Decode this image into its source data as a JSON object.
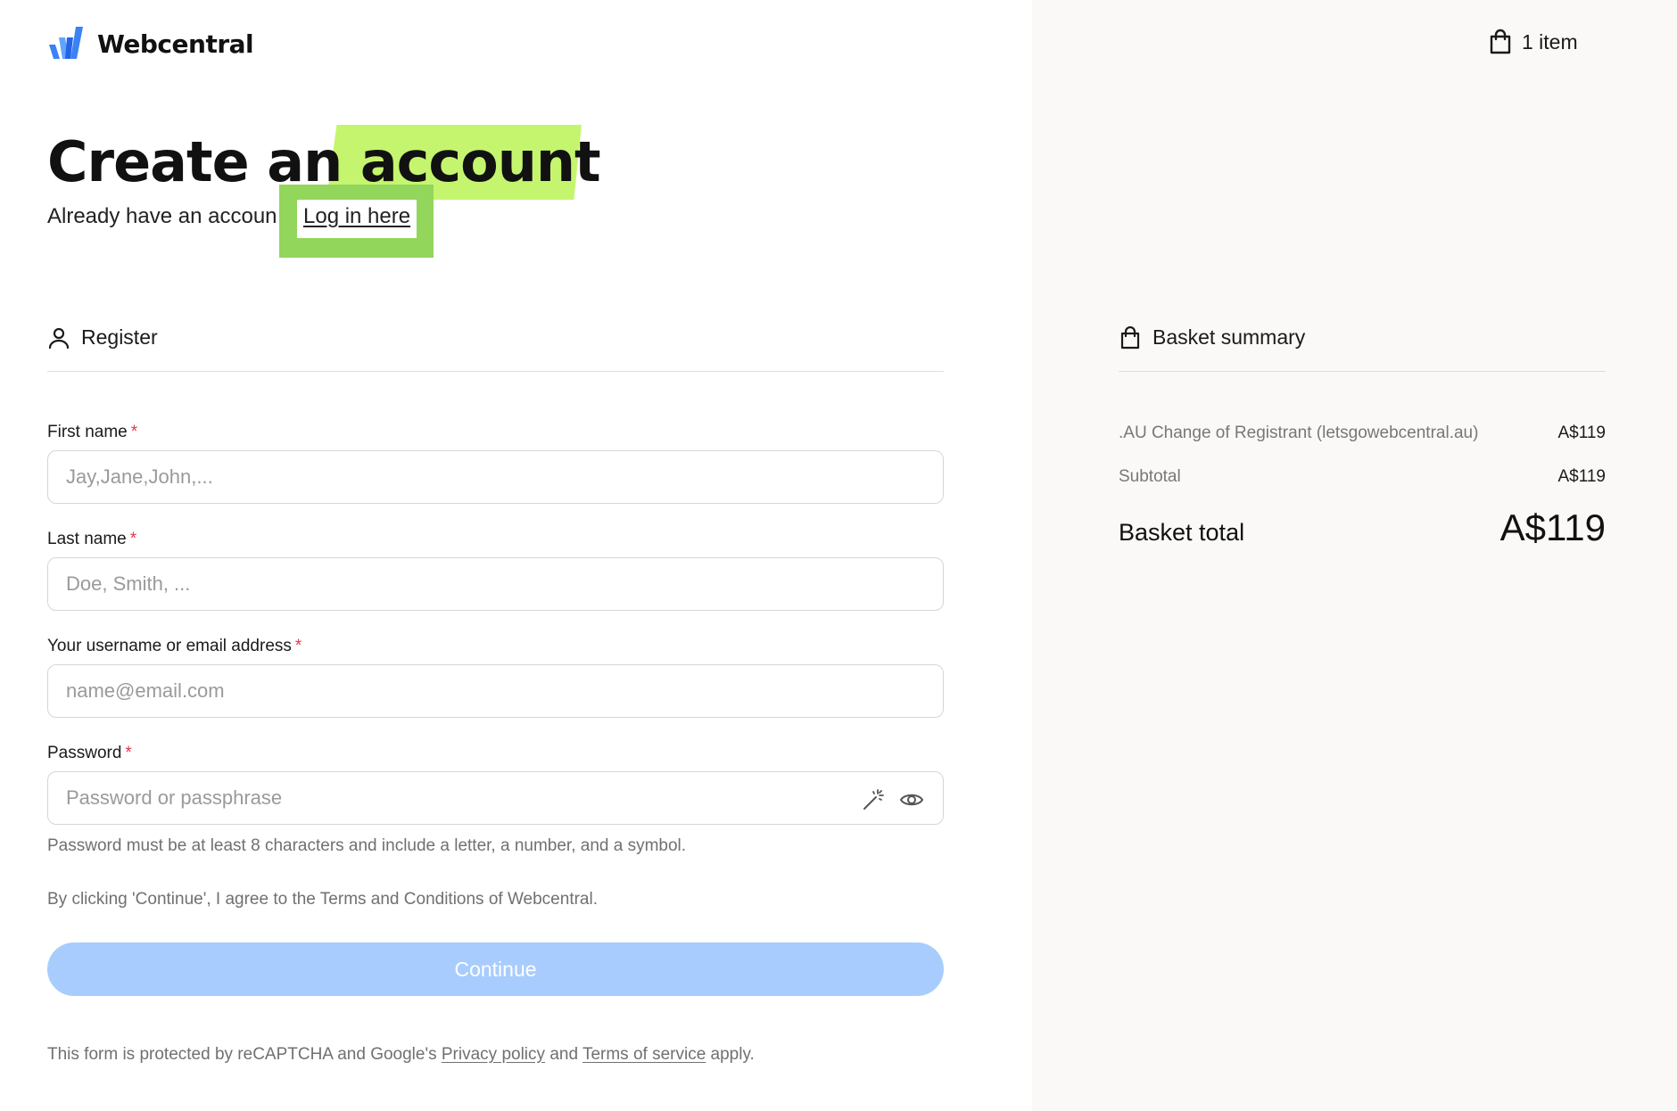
{
  "brand": {
    "name": "Webcentral",
    "accent": "#4a8cf0"
  },
  "cart": {
    "count_label": "1 item"
  },
  "heading": {
    "part1": "Create an",
    "part2": "account",
    "highlight_color": "#c5f56e"
  },
  "subtext": {
    "text": "Already have an accoun",
    "login_link": "Log in here",
    "highlight_color": "#92d65c"
  },
  "register": {
    "section_title": "Register",
    "fields": {
      "first_name": {
        "label": "First name",
        "required": "*",
        "placeholder": "Jay,Jane,John,..."
      },
      "last_name": {
        "label": "Last name",
        "required": "*",
        "placeholder": "Doe, Smith, ..."
      },
      "email": {
        "label": "Your username or email address",
        "required": "*",
        "placeholder": "name@email.com"
      },
      "password": {
        "label": "Password",
        "required": "*",
        "placeholder": "Password or passphrase",
        "hint": "Password must be at least 8 characters and include a letter, a number, and a symbol."
      }
    },
    "terms": "By clicking 'Continue', I agree to the Terms and Conditions of Webcentral.",
    "continue_label": "Continue",
    "continue_color": "#a8ccfd",
    "recaptcha": {
      "prefix": "This form is protected by reCAPTCHA and Google's",
      "privacy": "Privacy policy",
      "and": "and",
      "terms": "Terms of service",
      "suffix": "apply."
    }
  },
  "basket": {
    "section_title": "Basket summary",
    "items": [
      {
        "name": ".AU Change of Registrant (letsgowebcentral.au)",
        "price": "A$119"
      }
    ],
    "subtotal": {
      "label": "Subtotal",
      "value": "A$119"
    },
    "total": {
      "label": "Basket total",
      "value": "A$119"
    }
  }
}
